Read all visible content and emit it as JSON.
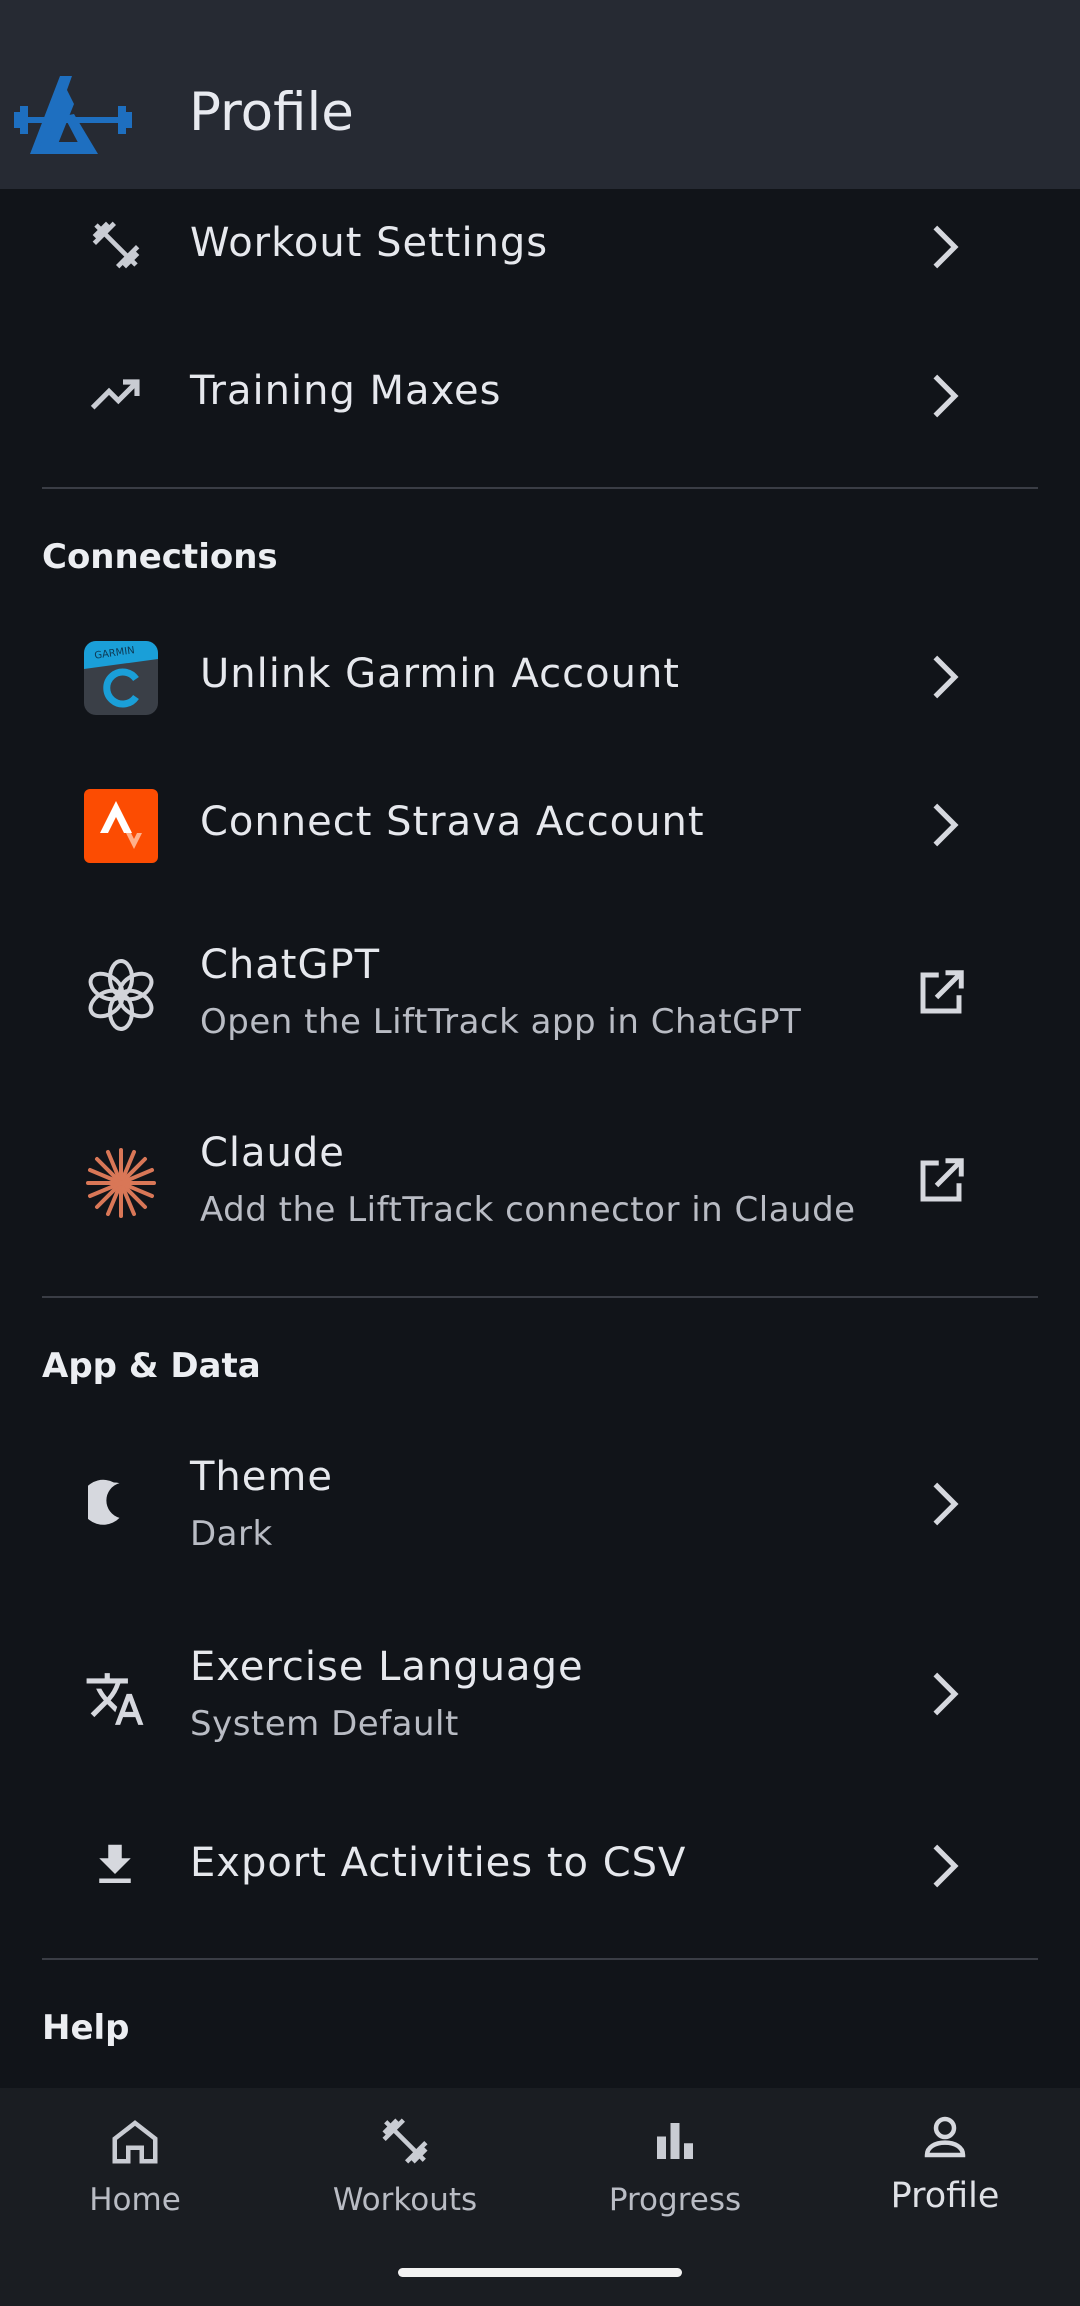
{
  "app": {
    "title": "Profile"
  },
  "training": {
    "items": [
      {
        "label": "Workout Settings",
        "icon": "dumbbell-icon"
      },
      {
        "label": "Training Maxes",
        "icon": "trending-up-icon"
      }
    ]
  },
  "connections": {
    "heading": "Connections",
    "items": [
      {
        "label": "Unlink Garmin Account",
        "icon": "garmin-icon",
        "brand_color": "#1a9fd8"
      },
      {
        "label": "Connect Strava Account",
        "icon": "strava-icon",
        "brand_color": "#fc4c02"
      },
      {
        "label": "ChatGPT",
        "sublabel": "Open the LiftTrack app in ChatGPT",
        "icon": "chatgpt-icon"
      },
      {
        "label": "Claude",
        "sublabel": "Add the LiftTrack connector in Claude",
        "icon": "claude-icon",
        "brand_color": "#d97757"
      }
    ]
  },
  "app_data": {
    "heading": "App & Data",
    "items": [
      {
        "label": "Theme",
        "sublabel": "Dark",
        "icon": "moon-icon"
      },
      {
        "label": "Exercise Language",
        "sublabel": "System Default",
        "icon": "translate-icon"
      },
      {
        "label": "Export Activities to CSV",
        "icon": "download-icon"
      }
    ]
  },
  "help": {
    "heading": "Help"
  },
  "nav": {
    "items": [
      {
        "label": "Home",
        "icon": "home-icon"
      },
      {
        "label": "Workouts",
        "icon": "dumbbell-icon"
      },
      {
        "label": "Progress",
        "icon": "bar-chart-icon"
      },
      {
        "label": "Profile",
        "icon": "person-icon",
        "selected": true
      }
    ]
  },
  "colors": {
    "background": "#111419",
    "appbar": "#262a33",
    "accent": "#1e6fc0"
  }
}
